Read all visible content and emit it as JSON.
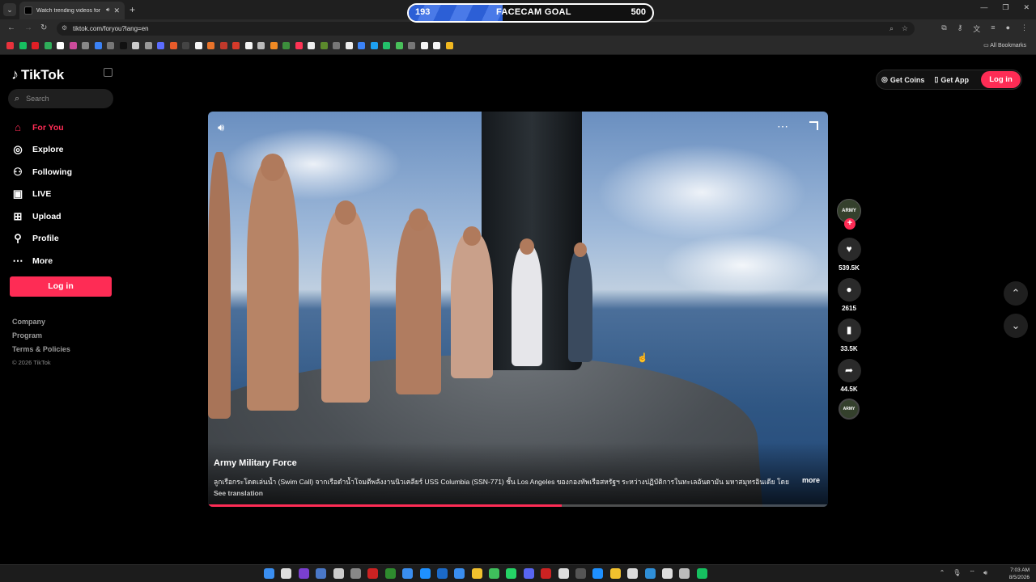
{
  "browser": {
    "tab_title": "Watch trending videos for you",
    "tab_audio_icon": "speaker-icon",
    "url": "tiktok.com/foryou?lang=en",
    "bookmarks_label": "All Bookmarks",
    "bookmark_colors": [
      "#e8323c",
      "#16c060",
      "#e01f26",
      "#2fae5a",
      "#ffffff",
      "#cc4b9b",
      "#888888",
      "#3b82f6",
      "#777777",
      "#111111",
      "#cccccc",
      "#999999",
      "#5b6cff",
      "#e85b2a",
      "#444444",
      "#f5f5f5",
      "#e8732a",
      "#c0392b",
      "#d63a2a",
      "#f5f5f5",
      "#bbbbbb",
      "#f08a24",
      "#3c8f3c",
      "#ff3355",
      "#eeeeee",
      "#5c8a2c",
      "#777777",
      "#eeeeee",
      "#3b82f6",
      "#1da1f2",
      "#23c16b",
      "#48c05a",
      "#777777",
      "#f5f5f5",
      "#f5f5f5",
      "#f2b820"
    ]
  },
  "overlay": {
    "goal_label": "FACECAM GOAL",
    "current": "193",
    "target": "500",
    "progress": 0.386
  },
  "sidebar": {
    "logo_text": "TikTok",
    "search_placeholder": "Search",
    "nav": [
      {
        "label": "For You",
        "icon": "home-icon",
        "active": true
      },
      {
        "label": "Explore",
        "icon": "compass-icon",
        "active": false
      },
      {
        "label": "Following",
        "icon": "following-icon",
        "active": false
      },
      {
        "label": "LIVE",
        "icon": "live-icon",
        "active": false
      },
      {
        "label": "Upload",
        "icon": "upload-icon",
        "active": false
      },
      {
        "label": "Profile",
        "icon": "profile-icon",
        "active": false
      },
      {
        "label": "More",
        "icon": "more-icon",
        "active": false
      }
    ],
    "login_label": "Log in",
    "footer": {
      "company": "Company",
      "program": "Program",
      "terms": "Terms & Policies",
      "copyright": "© 2026 TikTok"
    }
  },
  "header": {
    "get_coins": "Get Coins",
    "get_app": "Get App",
    "login": "Log in"
  },
  "video": {
    "author": "Army Military Force",
    "description": "ลูกเรือกระโดดเล่นน้ำ (Swim Call) จากเรือดำน้ำโจมตีพลังงานนิวเคลียร์ USS Columbia (SSN-771) ชั้น Los Angeles ของกองทัพเรือสหรัฐฯ ระหว่างปฏิบัติการในทะเลอันดามัน มหาสมุทรอินเดีย โดย",
    "more_label": "more",
    "see_translation": "See translation",
    "progress": 0.57
  },
  "actions": {
    "avatar_text": "ARMY",
    "likes": "539.5K",
    "comments": "2615",
    "saves": "33.5K",
    "shares": "44.5K"
  },
  "taskbar": {
    "icon_colors": [
      "#3a8ef0",
      "#dddddd",
      "#7a3fd0",
      "#4a78c8",
      "#cccccc",
      "#888888",
      "#cc2222",
      "#2e8b2e",
      "#3a8ef0",
      "#1e90ff",
      "#1b6ac9",
      "#3a8ef0",
      "#f2c12e",
      "#3fbf5c",
      "#25d366",
      "#5865f2",
      "#cc2222",
      "#dddddd",
      "#555555",
      "#1e90ff",
      "#f2c12e",
      "#dddddd",
      "#2f8fd8",
      "#dddddd",
      "#bbbbbb",
      "#16c060"
    ],
    "time": "7:03 AM",
    "date": "8/5/2026"
  }
}
